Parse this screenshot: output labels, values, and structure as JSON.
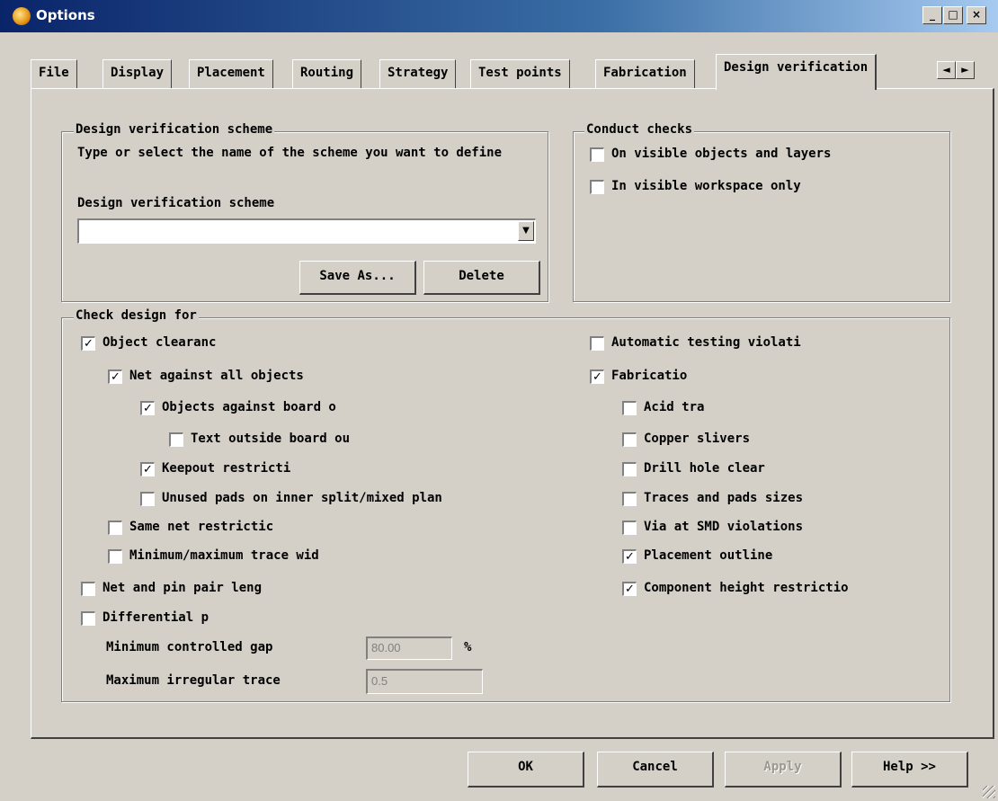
{
  "window": {
    "title": "Options",
    "minimize_glyph": "_",
    "maximize_glyph": "□",
    "close_glyph": "×"
  },
  "tabs": [
    "File",
    "Display",
    "Placement",
    "Routing",
    "Strategy",
    "Test points",
    "Fabrication",
    "Design verification"
  ],
  "active_tab": "Design verification",
  "tab_scroll": {
    "left": "◄",
    "right": "►"
  },
  "scheme_group": {
    "legend": "Design verification scheme",
    "instruction": "Type or select the name of the scheme you want to define",
    "field_label": "Design verification scheme",
    "selected_value": "",
    "save_as_label": "Save As...",
    "delete_label": "Delete"
  },
  "conduct_group": {
    "legend": "Conduct checks",
    "items": [
      {
        "label": "On visible objects and layers",
        "checked": false
      },
      {
        "label": "In visible workspace only",
        "checked": false
      }
    ]
  },
  "check_group": {
    "legend": "Check design for",
    "left_items": [
      {
        "label": "Object clearanc",
        "checked": true
      },
      {
        "label": "Net against all objects",
        "checked": true
      },
      {
        "label": "Objects against board o",
        "checked": true
      },
      {
        "label": "Text outside board ou",
        "checked": false
      },
      {
        "label": "Keepout restricti",
        "checked": true
      },
      {
        "label": "Unused pads on inner split/mixed plan",
        "checked": false
      },
      {
        "label": "Same net restrictic",
        "checked": false
      },
      {
        "label": "Minimum/maximum trace wid",
        "checked": false
      },
      {
        "label": "Net and pin pair leng",
        "checked": false
      },
      {
        "label": "Differential p",
        "checked": false
      }
    ],
    "right_items": [
      {
        "label": "Automatic testing violati",
        "checked": false
      },
      {
        "label": "Fabricatio",
        "checked": true
      },
      {
        "label": "Acid tra",
        "checked": false
      },
      {
        "label": "Copper slivers",
        "checked": false
      },
      {
        "label": "Drill hole clear",
        "checked": false
      },
      {
        "label": "Traces and pads sizes",
        "checked": false
      },
      {
        "label": "Via at SMD violations",
        "checked": false
      },
      {
        "label": "Placement outline",
        "checked": true
      },
      {
        "label": "Component height restrictio",
        "checked": true
      }
    ],
    "min_gap_label": "Minimum controlled gap",
    "min_gap_value": "80.00",
    "min_gap_unit": "%",
    "max_irregular_label": "Maximum irregular trace",
    "max_irregular_value": "0.5"
  },
  "footer": {
    "ok_label": "OK",
    "cancel_label": "Cancel",
    "apply_label": "Apply",
    "help_label": "Help >>"
  },
  "icons": {
    "check_glyph": "✓",
    "dropdown": "▼"
  }
}
